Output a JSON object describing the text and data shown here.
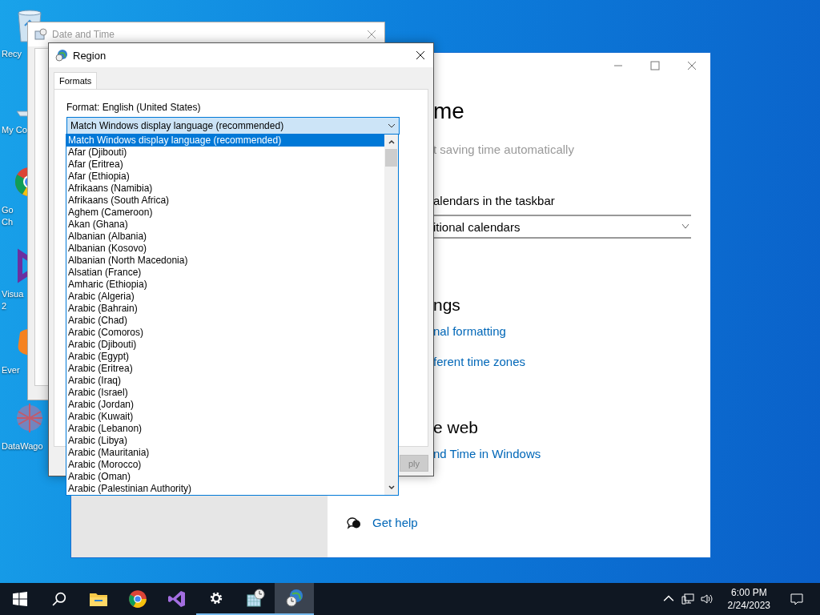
{
  "desktop_icons": [
    {
      "kind": "recycle-bin",
      "lines": [
        "Recy"
      ]
    },
    {
      "kind": "computer",
      "lines": [
        "My Co"
      ]
    },
    {
      "kind": "chrome",
      "lines": [
        "Go",
        "Ch"
      ]
    },
    {
      "kind": "visual-studio",
      "lines": [
        "Visua",
        "2"
      ]
    },
    {
      "kind": "evernote",
      "lines": [
        "Ever"
      ]
    },
    {
      "kind": "datawagon",
      "lines": [
        "DataWago"
      ]
    }
  ],
  "date_time_window": {
    "title": "Date and Time"
  },
  "region_window": {
    "title": "Region",
    "tabs": [
      {
        "label": "Formats",
        "selected": true
      }
    ],
    "format_label": "Format: English (United States)",
    "format_combo": {
      "value": "Match Windows display language (recommended)",
      "expanded": true
    },
    "options": [
      {
        "label": "Match Windows display language (recommended)",
        "selected": true
      },
      {
        "label": "Afar (Djibouti)",
        "selected": false
      },
      {
        "label": "Afar (Eritrea)",
        "selected": false
      },
      {
        "label": "Afar (Ethiopia)",
        "selected": false
      },
      {
        "label": "Afrikaans (Namibia)",
        "selected": false
      },
      {
        "label": "Afrikaans (South Africa)",
        "selected": false
      },
      {
        "label": "Aghem (Cameroon)",
        "selected": false
      },
      {
        "label": "Akan (Ghana)",
        "selected": false
      },
      {
        "label": "Albanian (Albania)",
        "selected": false
      },
      {
        "label": "Albanian (Kosovo)",
        "selected": false
      },
      {
        "label": "Albanian (North Macedonia)",
        "selected": false
      },
      {
        "label": "Alsatian (France)",
        "selected": false
      },
      {
        "label": "Amharic (Ethiopia)",
        "selected": false
      },
      {
        "label": "Arabic (Algeria)",
        "selected": false
      },
      {
        "label": "Arabic (Bahrain)",
        "selected": false
      },
      {
        "label": "Arabic (Chad)",
        "selected": false
      },
      {
        "label": "Arabic (Comoros)",
        "selected": false
      },
      {
        "label": "Arabic (Djibouti)",
        "selected": false
      },
      {
        "label": "Arabic (Egypt)",
        "selected": false
      },
      {
        "label": "Arabic (Eritrea)",
        "selected": false
      },
      {
        "label": "Arabic (Iraq)",
        "selected": false
      },
      {
        "label": "Arabic (Israel)",
        "selected": false
      },
      {
        "label": "Arabic (Jordan)",
        "selected": false
      },
      {
        "label": "Arabic (Kuwait)",
        "selected": false
      },
      {
        "label": "Arabic (Lebanon)",
        "selected": false
      },
      {
        "label": "Arabic (Libya)",
        "selected": false
      },
      {
        "label": "Arabic (Mauritania)",
        "selected": false
      },
      {
        "label": "Arabic (Morocco)",
        "selected": false
      },
      {
        "label": "Arabic (Oman)",
        "selected": false
      },
      {
        "label": "Arabic (Palestinian Authority)",
        "selected": false
      }
    ],
    "apply_button": {
      "label": "ply",
      "disabled": true
    }
  },
  "settings_window": {
    "heading": "me",
    "dst_text": "t saving time automatically",
    "calendars_label": "alendars in the taskbar",
    "calendars_dropdown": "itional calendars",
    "related_heading": "ngs",
    "related_links": [
      "nal formatting",
      "ferent time zones"
    ],
    "web_heading": "e web",
    "web_links": [
      "nd Time in Windows"
    ],
    "help_link": "Get help"
  },
  "taskbar": {
    "apps": [
      {
        "kind": "explorer",
        "running": false,
        "active": false
      },
      {
        "kind": "chrome",
        "running": false,
        "active": false
      },
      {
        "kind": "visual-studio",
        "running": false,
        "active": false
      },
      {
        "kind": "settings",
        "running": true,
        "active": false
      },
      {
        "kind": "date-time",
        "running": true,
        "active": false
      },
      {
        "kind": "region",
        "running": true,
        "active": true
      }
    ],
    "clock": {
      "time": "6:00 PM",
      "date": "2/24/2023"
    }
  }
}
